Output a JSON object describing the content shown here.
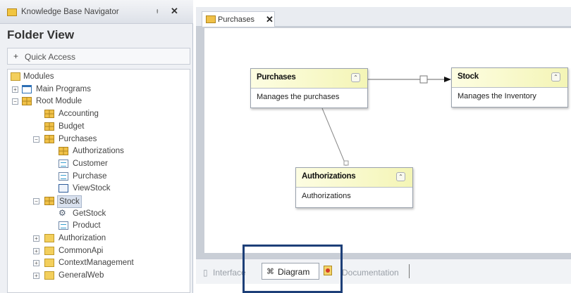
{
  "navigator": {
    "title": "Knowledge Base Navigator",
    "pin": "ᴑ",
    "close": "✕",
    "folder_view": "Folder View",
    "quick_access_plus": "+",
    "quick_access": "Quick Access",
    "tree": [
      {
        "label": "Modules",
        "icon": "modules-folder-icon"
      },
      {
        "label": "Main Programs",
        "icon": "main-programs-icon"
      },
      {
        "label": "Root Module",
        "icon": "module-icon"
      },
      {
        "label": "Accounting",
        "icon": "module-icon"
      },
      {
        "label": "Budget",
        "icon": "module-icon"
      },
      {
        "label": "Purchases",
        "icon": "module-icon"
      },
      {
        "label": "Authorizations",
        "icon": "module-icon"
      },
      {
        "label": "Customer",
        "icon": "transaction-icon"
      },
      {
        "label": "Purchase",
        "icon": "transaction-icon"
      },
      {
        "label": "ViewStock",
        "icon": "webpanel-icon"
      },
      {
        "label": "Stock",
        "icon": "module-icon"
      },
      {
        "label": "GetStock",
        "icon": "procedure-icon"
      },
      {
        "label": "Product",
        "icon": "transaction-icon"
      },
      {
        "label": "Authorization",
        "icon": "folder-icon"
      },
      {
        "label": "CommonApi",
        "icon": "folder-icon"
      },
      {
        "label": "ContextManagement",
        "icon": "folder-icon"
      },
      {
        "label": "GeneralWeb",
        "icon": "folder-icon"
      }
    ]
  },
  "editor": {
    "tab_label": "Purchases",
    "tab_close": "✕"
  },
  "diagram": {
    "boxes": {
      "purchases": {
        "name": "Purchases",
        "desc": "Manages  the purchases"
      },
      "stock": {
        "name": "Stock",
        "desc": "Manages  the Inventory"
      },
      "authorizations": {
        "name": "Authorizations",
        "desc": "Authorizations"
      }
    },
    "collapse_glyph": "⌃"
  },
  "bottom_tabs": {
    "interface": "Interface",
    "diagram": "Diagram",
    "documentation": "Documentation"
  },
  "colors": {
    "highlight": "#1d3f78",
    "box_header": "#f4f5b6"
  }
}
